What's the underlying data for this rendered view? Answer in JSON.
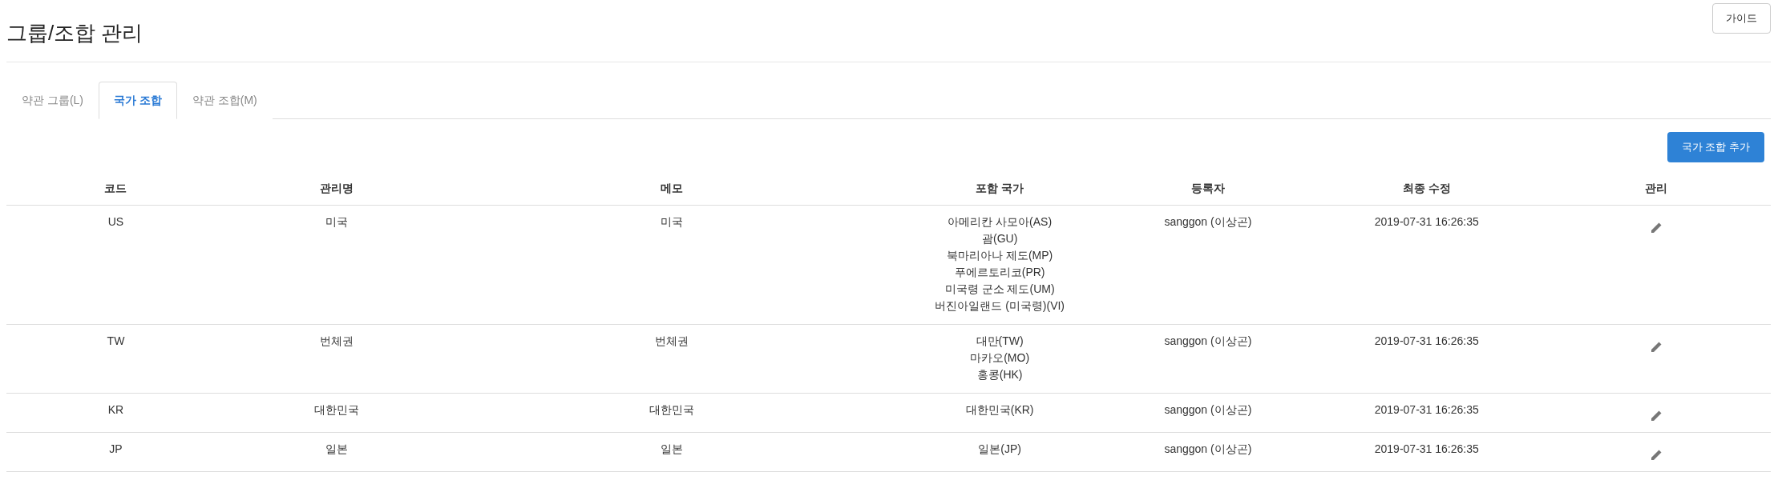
{
  "page": {
    "title": "그룹/조합 관리",
    "guide_button": "가이드"
  },
  "tabs": [
    {
      "label": "약관 그룹(L)",
      "selected": false
    },
    {
      "label": "국가 조합",
      "selected": true
    },
    {
      "label": "약관 조합(M)",
      "selected": false
    }
  ],
  "add_button": "국가 조합 추가",
  "table": {
    "columns": [
      "코드",
      "관리명",
      "메모",
      "포함 국가",
      "등록자",
      "최종 수정",
      "관리"
    ],
    "rows": [
      {
        "code": "US",
        "name": "미국",
        "memo": "미국",
        "countries": [
          "아메리칸 사모아(AS)",
          "괌(GU)",
          "북마리아나 제도(MP)",
          "푸에르토리코(PR)",
          "미국령 군소 제도(UM)",
          "버진아일랜드 (미국령)(VI)"
        ],
        "registrant": "sanggon (이상곤)",
        "modified": "2019-07-31 16:26:35"
      },
      {
        "code": "TW",
        "name": "번체권",
        "memo": "번체권",
        "countries": [
          "대만(TW)",
          "마카오(MO)",
          "홍콩(HK)"
        ],
        "registrant": "sanggon (이상곤)",
        "modified": "2019-07-31 16:26:35"
      },
      {
        "code": "KR",
        "name": "대한민국",
        "memo": "대한민국",
        "countries": [
          "대한민국(KR)"
        ],
        "registrant": "sanggon (이상곤)",
        "modified": "2019-07-31 16:26:35"
      },
      {
        "code": "JP",
        "name": "일본",
        "memo": "일본",
        "countries": [
          "일본(JP)"
        ],
        "registrant": "sanggon (이상곤)",
        "modified": "2019-07-31 16:26:35"
      }
    ]
  }
}
